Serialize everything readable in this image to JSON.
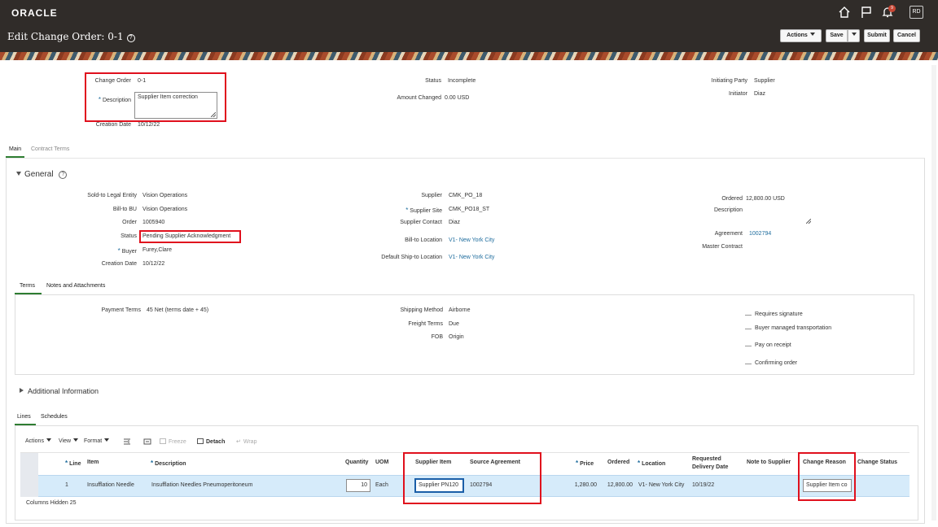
{
  "brand": {
    "logo": "ORACLE",
    "user_initials": "RD",
    "notification_count": "9"
  },
  "header": {
    "title": "Edit Change Order: 0-1",
    "help": "?",
    "actions_label": "Actions",
    "save_label": "Save",
    "submit_label": "Submit",
    "cancel_label": "Cancel"
  },
  "summary": {
    "change_order_label": "Change Order",
    "change_order_value": "0-1",
    "description_label": "Description",
    "description_value": "Supplier Item correction",
    "creation_date_label": "Creation Date",
    "creation_date_value": "10/12/22",
    "status_label": "Status",
    "status_value": "Incomplete",
    "amount_changed_label": "Amount Changed",
    "amount_changed_value": "0.00 USD",
    "initiating_party_label": "Initiating Party",
    "initiating_party_value": "Supplier",
    "initiator_label": "Initiator",
    "initiator_value": "Diaz"
  },
  "main_tabs": {
    "main": "Main",
    "contract_terms": "Contract Terms"
  },
  "general": {
    "title": "General",
    "sold_to_label": "Sold-to Legal Entity",
    "sold_to_value": "Vision Operations",
    "bill_to_bu_label": "Bill-to BU",
    "bill_to_bu_value": "Vision Operations",
    "order_label": "Order",
    "order_value": "1005940",
    "status_label": "Status",
    "status_value": "Pending Supplier Acknowledgment",
    "buyer_label": "Buyer",
    "buyer_value": "Furey,Clare",
    "creation_date_label": "Creation Date",
    "creation_date_value": "10/12/22",
    "supplier_label": "Supplier",
    "supplier_value": "CMK_PO_18",
    "supplier_site_label": "Supplier Site",
    "supplier_site_value": "CMK_PO18_ST",
    "supplier_contact_label": "Supplier Contact",
    "supplier_contact_value": "Diaz",
    "bill_to_location_label": "Bill-to Location",
    "bill_to_location_value": "V1- New York City",
    "ship_to_label": "Default Ship-to Location",
    "ship_to_value": "V1- New York City",
    "ordered_label": "Ordered",
    "ordered_value": "12,800.00 USD",
    "description_label": "Description",
    "agreement_label": "Agreement",
    "agreement_value": "1002794",
    "master_contract_label": "Master Contract"
  },
  "terms_tabs": {
    "terms": "Terms",
    "notes": "Notes and Attachments"
  },
  "terms": {
    "payment_terms_label": "Payment Terms",
    "payment_terms_value": "45 Net (terms date + 45)",
    "shipping_method_label": "Shipping Method",
    "shipping_method_value": "Airborne",
    "freight_terms_label": "Freight Terms",
    "freight_terms_value": "Due",
    "fob_label": "FOB",
    "fob_value": "Origin",
    "checks": [
      "Requires signature",
      "Buyer managed transportation",
      "Pay on receipt",
      "Confirming order"
    ]
  },
  "additional_info": {
    "title": "Additional Information"
  },
  "lines_tabs": {
    "lines": "Lines",
    "schedules": "Schedules"
  },
  "lines_toolbar": {
    "actions": "Actions",
    "view": "View",
    "format": "Format",
    "freeze": "Freeze",
    "detach": "Detach",
    "wrap": "Wrap"
  },
  "lines_table": {
    "headers": {
      "line": "Line",
      "item": "Item",
      "description": "Description",
      "quantity": "Quantity",
      "uom": "UOM",
      "supplier_item": "Supplier Item",
      "source_agreement": "Source Agreement",
      "price": "Price",
      "ordered": "Ordered",
      "location": "Location",
      "requested_delivery_1": "Requested",
      "requested_delivery_2": "Delivery Date",
      "note_to_supplier": "Note to Supplier",
      "change_reason": "Change Reason",
      "change_status": "Change Status"
    },
    "row": {
      "line": "1",
      "item": "Insufflation Needle",
      "description": "Insufflation Needles Pneumoperitoneum",
      "quantity": "10",
      "uom": "Each",
      "supplier_item": "Supplier PN120",
      "source_agreement": "1002794",
      "price": "1,280.00",
      "ordered": "12,800.00",
      "location": "V1- New York City",
      "requested_delivery": "10/19/22",
      "change_reason": "Supplier Item co"
    },
    "columns_hidden_label": "Columns Hidden",
    "columns_hidden_value": "25"
  }
}
